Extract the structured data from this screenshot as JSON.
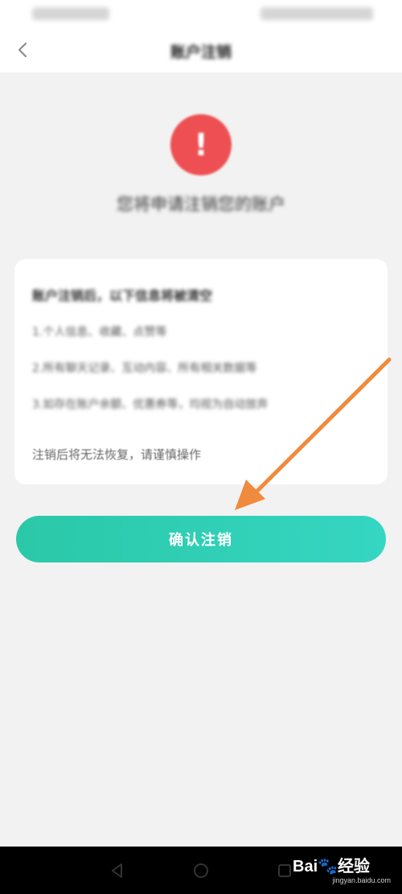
{
  "status_bar": {
    "left": "",
    "right": ""
  },
  "nav": {
    "title": "账户注销"
  },
  "warning": {
    "title": "您将申请注销您的账户"
  },
  "card": {
    "heading": "账户注销后，以下信息将被清空",
    "lines": [
      "1.个人信息、收藏、点赞等",
      "2.所有聊天记录、互动内容、所有相关数据等",
      "3.如存在账户余额、优惠券等，均视为自动放弃"
    ],
    "warning_note": "注销后将无法恢复，请谨慎操作"
  },
  "confirm_button": {
    "label": "确认注销"
  },
  "watermark": {
    "brand_prefix": "Bai",
    "brand_suffix": "经验",
    "url": "jingyan.baidu.com"
  },
  "colors": {
    "accent": "#2bc8a8",
    "warning": "#ee4f52",
    "annotation_arrow": "#f08a3c"
  }
}
